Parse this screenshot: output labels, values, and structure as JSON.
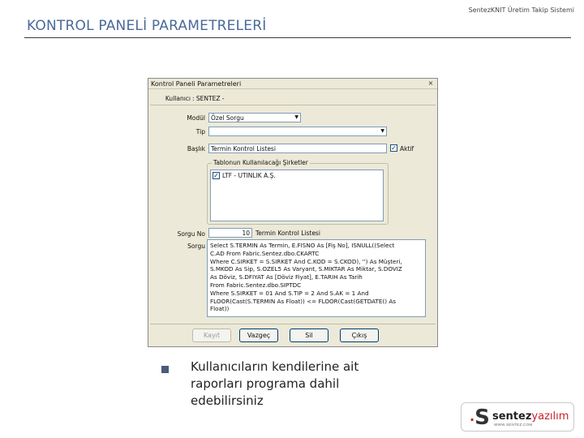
{
  "slide": {
    "title": "KONTROL PANELİ PARAMETRELERİ",
    "header_right": "SentezKNIT Üretim Takip Sistemi"
  },
  "window": {
    "title": "Kontrol Paneli Parametreleri",
    "close_glyph": "×",
    "kullanici_label": "Kullanıcı",
    "kullanici_value": ": SENTEZ -",
    "modul_label": "Modül",
    "modul_value": "Özel Sorgu",
    "tip_label": "Tip",
    "tip_value": "",
    "baslik_label": "Başlık",
    "baslik_value": "Termin Kontrol Listesi",
    "aktif_label": "Aktif",
    "aktif_checked": "✓",
    "group_title": "Tablonun Kullanılacağı Şirketler",
    "companies": [
      {
        "checked": "✓",
        "name": "LTF - UTINLIK A.Ş."
      }
    ],
    "sorgu_no_label": "Sorgu No",
    "sorgu_no_value": "10",
    "sorgu_no_desc": "Termin Kontrol Listesi",
    "sorgu_label": "Sorgu",
    "sorgu_lines": [
      "Select S.TERMIN As Termin, E.FISNO As [Fiş No], ISNULL((Select",
      "C.AD From Fabric.Sentez.dbo.CKARTC",
      "Where C.SIRKET = S.SIRKET And C.KOD = S.CKOD), '') As Müşteri,",
      "S.MKOD As Sip, S.OZEL5 As Varyant, S.MIKTAR As Miktar, S.DOVIZ",
      "As Döviz, S.DFIYAT As [Döviz Fiyat], E.TARIH As Tarih",
      "From Fabric.Sentez.dbo.SIPTDC",
      "Where S.SIRKET = 01 And S.TIP = 2 And S.AK = 1 And",
      "  FLOOR(Cast(S.TERMIN As Float)) <= FLOOR(Cast(GETDATE() As",
      "  Float))"
    ],
    "buttons": {
      "kayit": "Kayıt",
      "vazgec": "Vazgeç",
      "sil": "Sil",
      "cikis": "Çıkış"
    }
  },
  "bullet": {
    "text": "Kullanıcıların kendilerine ait raporları programa dahil edebilirsiniz"
  },
  "logo": {
    "mark": "S",
    "word_a": "sentez",
    "word_b": "yazılım",
    "url": "WWW.SENTEZ.COM"
  },
  "colors": {
    "title": "#4a6a9a",
    "window_bg": "#ece9d8",
    "field_border": "#7f9db9",
    "logo_red": "#c8202a"
  }
}
